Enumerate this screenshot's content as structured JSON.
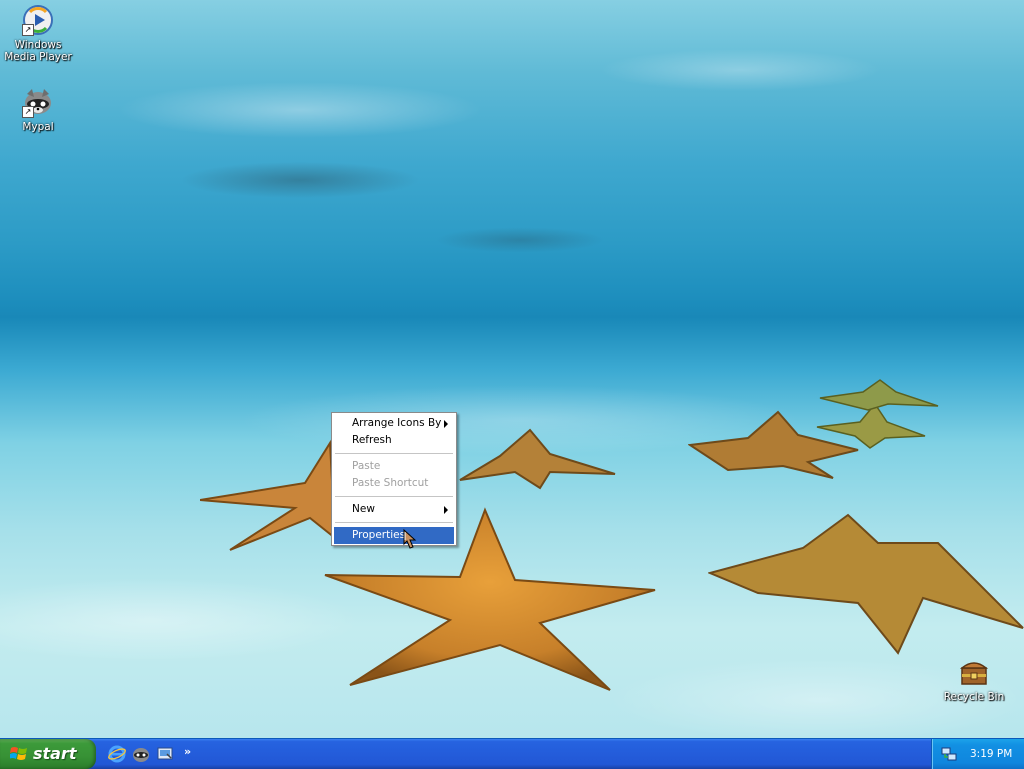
{
  "desktop": {
    "icons": [
      {
        "label": "Windows Media Player",
        "icon": "windows-media-player-icon"
      },
      {
        "label": "Mypal",
        "icon": "mypal-raccoon-icon"
      },
      {
        "label": "Recycle Bin",
        "icon": "recycle-bin-icon"
      }
    ]
  },
  "context_menu": {
    "items": [
      {
        "label": "Arrange Icons By",
        "submenu": true,
        "enabled": true
      },
      {
        "label": "Refresh",
        "submenu": false,
        "enabled": true
      },
      {
        "label": "Paste",
        "submenu": false,
        "enabled": false
      },
      {
        "label": "Paste Shortcut",
        "submenu": false,
        "enabled": false
      },
      {
        "label": "New",
        "submenu": true,
        "enabled": true
      },
      {
        "label": "Properties",
        "submenu": false,
        "enabled": true,
        "highlighted": true
      }
    ],
    "highlight_color": "#316ac5"
  },
  "taskbar": {
    "start_label": "start",
    "quick_launch": [
      "internet-explorer-icon",
      "mypal-icon",
      "show-desktop-icon"
    ],
    "overflow_label": "»",
    "color": "#245edc"
  },
  "tray": {
    "icons": [
      "network-icon"
    ],
    "clock": "3:19 PM"
  }
}
